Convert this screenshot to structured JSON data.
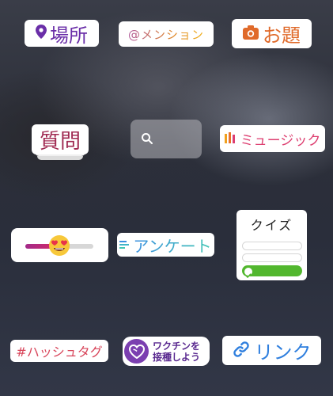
{
  "stickers": {
    "location": {
      "label": "場所",
      "icon": "location-pin-icon",
      "color": "#6a2ea8"
    },
    "mention": {
      "label": "@メンション"
    },
    "odai": {
      "label": "お題",
      "icon": "camera-icon",
      "color": "#e06a2a"
    },
    "question": {
      "label": "質問",
      "color": "#a02a52"
    },
    "search": {
      "icon": "search-icon"
    },
    "music": {
      "label": "ミュージック",
      "icon": "music-bars-icon",
      "color": "#dd3e70"
    },
    "emoji_slider": {
      "emoji": "heart-eyes-emoji",
      "level": 0.42
    },
    "poll": {
      "label": "アンケート",
      "icon": "poll-lines-icon"
    },
    "quiz": {
      "title": "クイズ",
      "options_count": 3,
      "correct_index": 2,
      "accent": "#52b72e"
    },
    "hashtag": {
      "label": "#ハッシュタグ",
      "color": "#d8455a"
    },
    "vaccine": {
      "line1": "ワクチンを",
      "line2": "接種しよう",
      "icon": "heart-badge-icon",
      "color": "#7b3fb0"
    },
    "link": {
      "label": "リンク",
      "icon": "link-icon",
      "color": "#2f7fde"
    }
  }
}
